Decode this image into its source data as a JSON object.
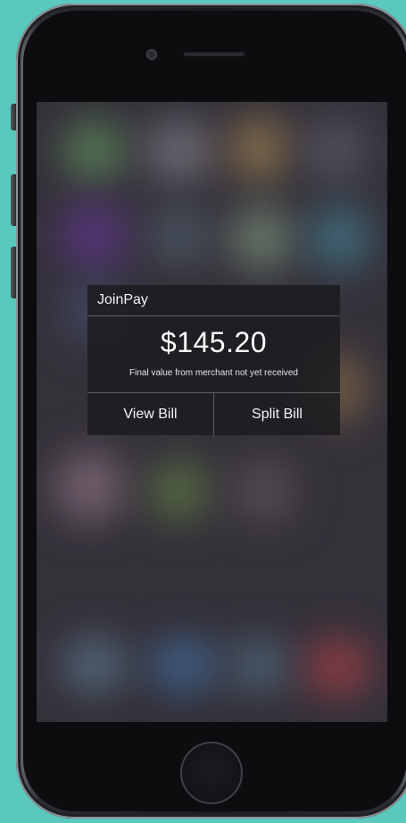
{
  "widget": {
    "app_name": "JoinPay",
    "amount": "$145.20",
    "status": "Final value from merchant not yet received",
    "actions": {
      "view_bill": "View Bill",
      "split_bill": "Split Bill"
    }
  },
  "colors": {
    "background": "#5bc8bd",
    "widget_bg": "#1c1c20",
    "text": "#ffffff"
  }
}
